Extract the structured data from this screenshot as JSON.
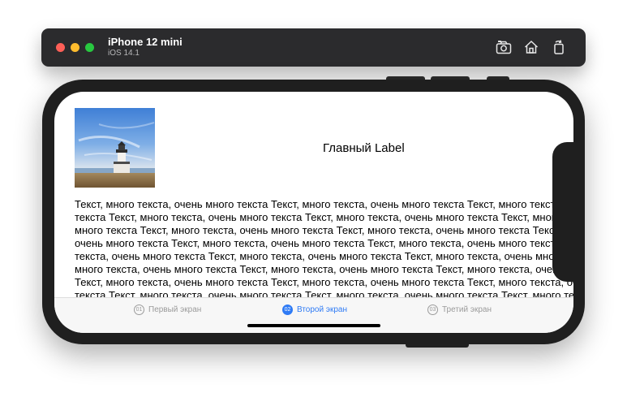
{
  "simulator": {
    "device_name": "iPhone 12 mini",
    "os_version": "iOS 14.1",
    "toolbar_icons": [
      "screenshot-icon",
      "home-icon",
      "rotate-icon"
    ]
  },
  "app": {
    "main_label": "Главный Label",
    "image": "lighthouse-photo",
    "body_text": "Текст, много текста, очень много текста Текст, много текста, очень много текста Текст, много текста, очень много текста Текст, много текста, очень много текста Текст, много текста, очень много текста Текст, много текста, очень много текста Текст, много текста, очень много текста Текст, много текста, очень много текста Текст, много текста, очень много текста Текст, много текста, очень много текста Текст, много текста, очень много текста Текст, много текста, очень много текста Текст, много текста, очень много текста Текст, много текста, очень много текста Текст, много текста, очень много текста Текст, много текста, очень много текста Текст, много текста, очень много текста Текст, много текста, очень много текста Текст, много текста, очень много текста Текст, много текста, очень много текста Текст, много текста, очень много текста Текст, много текста, очень много текста Текст, много текста, очень много текста Текст, много текста, очень много текста",
    "tabs": [
      {
        "number": "01",
        "label": "Первый экран",
        "active": false
      },
      {
        "number": "02",
        "label": "Второй экран",
        "active": true
      },
      {
        "number": "03",
        "label": "Третий экран",
        "active": false
      }
    ]
  },
  "colors": {
    "accent": "#2f7bf5",
    "inactive_tab": "#9b9b9b",
    "device_frame": "#1f1f1f",
    "toolbar_bg": "#2b2b2d"
  }
}
